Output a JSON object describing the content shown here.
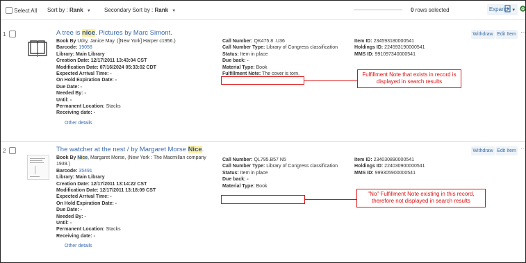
{
  "toolbar": {
    "select_all": "Select All",
    "sort_label": "Sort by :",
    "sort_value": "Rank",
    "secondary_sort_label": "Secondary Sort by :",
    "secondary_sort_value": "Rank",
    "rows_selected_count": "0",
    "rows_selected_label": "rows selected",
    "expand_label": "Expand",
    "export_icon": "export-icon",
    "settings_icon": "gear-icon"
  },
  "records": [
    {
      "number": "1",
      "title_pre": "A tree is ",
      "title_hl": "nice",
      "title_post": ". Pictures by Marc Simont.",
      "left": {
        "book_by_label": "Book By",
        "book_by_value": "Udry, Janice May. ([New York] Harper c1956.)",
        "barcode_label": "Barcode:",
        "barcode_value": "19058",
        "library": "Library: Main Library",
        "creation": "Creation Date: 12/17/2011 13:43:04 CST",
        "modification": "Modification Date: 07/16/2024 05:33:02 CDT",
        "expected_arrival": "Expected Arrival Time: -",
        "on_hold": "On Hold Expiration Date: -",
        "due_date": "Due Date: -",
        "needed_by": "Needed By: -",
        "until": "Until: -",
        "location_label": "Permanent Location:",
        "location_value": "Stacks",
        "receiving": "Receiving date: -",
        "other_details": "Other details"
      },
      "mid": {
        "call_number_label": "Call Number:",
        "call_number_value": "QK475.8 .U36",
        "call_type_label": "Call Number Type:",
        "call_type_value": "Library of Congress classification",
        "status_label": "Status:",
        "status_value": "Item in place",
        "due_back": "Due back: -",
        "material_label": "Material Type:",
        "material_value": "Book",
        "fulfillment_label": "Fulfillment Note:",
        "fulfillment_value": "The cover is torn."
      },
      "right": {
        "item_id_label": "Item ID:",
        "item_id_value": "234593180000541",
        "holdings_label": "Holdings ID:",
        "holdings_value": "224593190000541",
        "mms_label": "MMS ID:",
        "mms_value": "991097340000541"
      },
      "withdraw": "Withdraw",
      "edit_item": "Edit Item",
      "more": "···"
    },
    {
      "number": "2",
      "title_pre": "The watcher at the nest / by Margaret Morse ",
      "title_hl": "Nice",
      "title_post": ".",
      "left": {
        "book_by_label": "Book By",
        "book_by_pre": " ",
        "book_by_hl": "Nice",
        "book_by_value": ", Margaret Morse, (New York : The Macmillan company 1939.)",
        "barcode_label": "Barcode:",
        "barcode_value": "35491",
        "library": "Library: Main Library",
        "creation": "Creation Date: 12/17/2011 13:14:22 CST",
        "modification": "Modification Date: 12/17/2011 13:18:09 CST",
        "expected_arrival": "Expected Arrival Time: -",
        "on_hold": "On Hold Expiration Date: -",
        "due_date": "Due Date: -",
        "needed_by": "Needed By: -",
        "until": "Until: -",
        "location_label": "Permanent Location:",
        "location_value": "Stacks",
        "receiving": "Receiving date: -",
        "other_details": "Other details"
      },
      "mid": {
        "call_number_label": "Call Number:",
        "call_number_value": "QL795.B57 N5",
        "call_type_label": "Call Number Type:",
        "call_type_value": "Library of Congress classification",
        "status_label": "Status:",
        "status_value": "Item in place",
        "due_back": "Due back: -",
        "material_label": "Material Type:",
        "material_value": "Book"
      },
      "right": {
        "item_id_label": "Item ID:",
        "item_id_value": "234030890000541",
        "holdings_label": "Holdings ID:",
        "holdings_value": "224030900000541",
        "mms_label": "MMS ID:",
        "mms_value": "999305900000541"
      },
      "withdraw": "Withdraw",
      "edit_item": "Edit Item",
      "more": "···"
    }
  ],
  "annotations": {
    "callout_1": "Fulfillment Note that exists in record is displayed in search results",
    "callout_2": "\"No\" Fulfillment Note existing in this record, therefore not displayed in search results"
  },
  "colors": {
    "link": "#3b6bb0",
    "highlight": "#fff0a8",
    "annotation": "#d11111"
  }
}
